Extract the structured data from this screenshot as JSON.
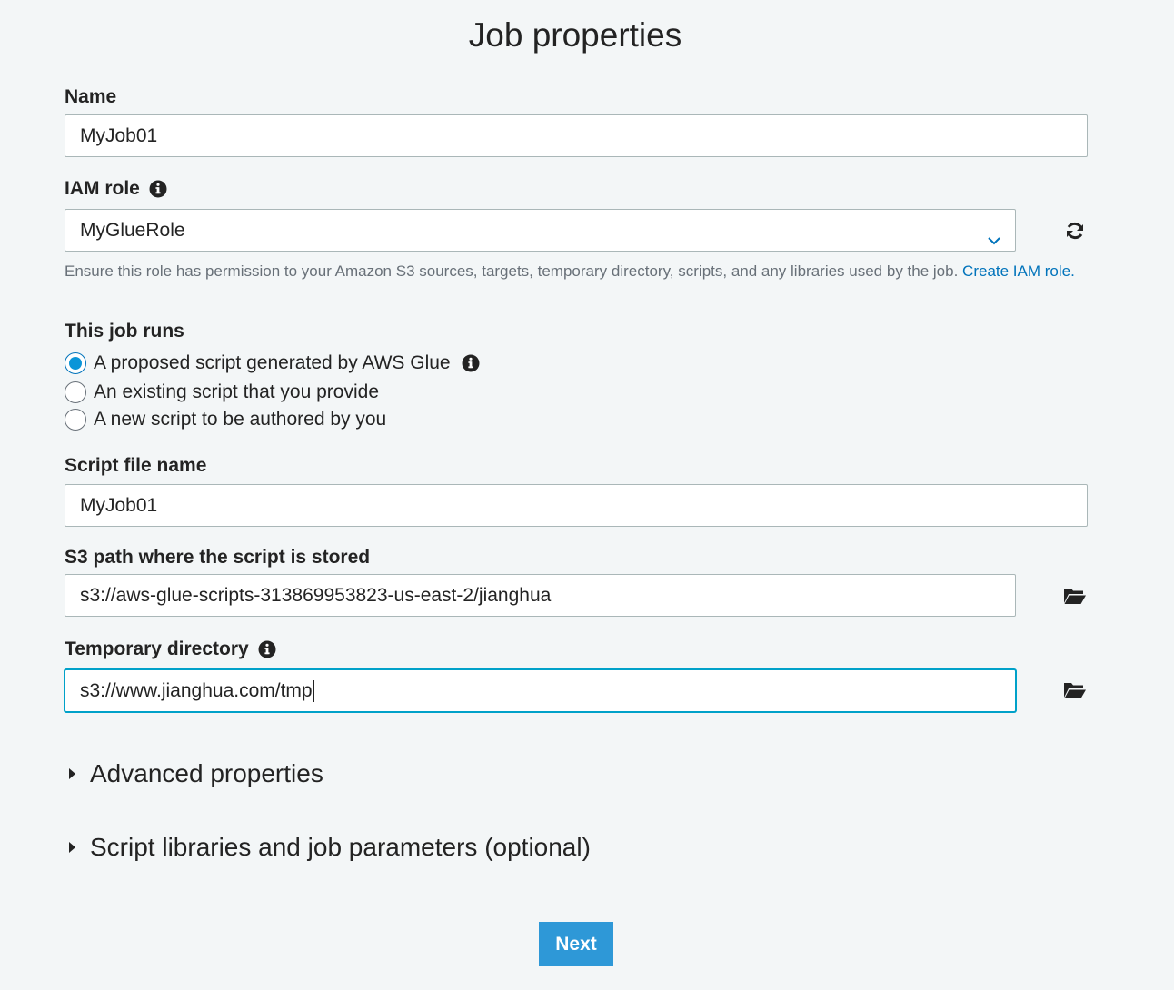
{
  "page": {
    "title": "Job properties"
  },
  "name_field": {
    "label": "Name",
    "value": "MyJob01"
  },
  "iam_role": {
    "label": "IAM role",
    "value": "MyGlueRole",
    "helper": "Ensure this role has permission to your Amazon S3 sources, targets, temporary directory, scripts, and any libraries used by the job.",
    "create_link": "Create IAM role."
  },
  "job_runs": {
    "label": "This job runs",
    "options": [
      {
        "label": "A proposed script generated by AWS Glue",
        "checked": true
      },
      {
        "label": "An existing script that you provide",
        "checked": false
      },
      {
        "label": "A new script to be authored by you",
        "checked": false
      }
    ]
  },
  "script_file": {
    "label": "Script file name",
    "value": "MyJob01"
  },
  "s3_path": {
    "label": "S3 path where the script is stored",
    "value": "s3://aws-glue-scripts-313869953823-us-east-2/jianghua"
  },
  "temp_dir": {
    "label": "Temporary directory",
    "value": "s3://www.jianghua.com/tmp"
  },
  "sections": {
    "advanced": "Advanced properties",
    "libraries": "Script libraries and job parameters (optional)"
  },
  "actions": {
    "next": "Next"
  },
  "colors": {
    "accent": "#0073bb",
    "button": "#2e98d7",
    "background": "#f3f6f7"
  },
  "icons": {
    "info": "info-icon",
    "refresh": "refresh-icon",
    "folder": "folder-open-icon",
    "chevron": "chevron-down-icon",
    "expand": "caret-right-icon"
  }
}
